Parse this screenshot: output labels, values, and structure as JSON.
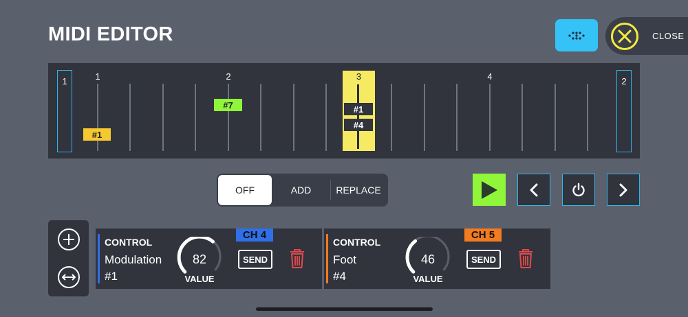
{
  "header": {
    "title": "MIDI EDITOR",
    "close_label": "CLOSE"
  },
  "colors": {
    "background": "#5a616c",
    "panel": "#31333d",
    "accent_blue": "#35c2f6",
    "marker_blue": "#2fb7ec",
    "playhead_yellow": "#f6ea62",
    "event_yellow": "#f6c930",
    "event_green": "#8ff63a",
    "close_yellow": "#f6ea3e",
    "play_green": "#8ff63a",
    "channel_blue": "#2f6fe8",
    "channel_orange": "#f27a1f",
    "trash_red": "#e24a4a"
  },
  "timeline": {
    "loop_start_label": "1",
    "loop_end_label": "2",
    "beats": [
      "1",
      "2",
      "3",
      "4"
    ],
    "playhead_label": "3",
    "events": [
      {
        "label": "#1",
        "color": "yellow"
      },
      {
        "label": "#7",
        "color": "green"
      }
    ],
    "playhead_events": [
      "#1",
      "#4"
    ]
  },
  "mode": {
    "options": [
      "OFF",
      "ADD",
      "REPLACE"
    ],
    "selected": "OFF"
  },
  "transport": {
    "icons": [
      "play-icon",
      "chevron-left-icon",
      "power-icon",
      "chevron-right-icon"
    ]
  },
  "side_panel": {
    "icons": [
      "add-circle-icon",
      "swap-horizontal-icon"
    ]
  },
  "cards": [
    {
      "type": "CONTROL",
      "name": "Modulation",
      "ref": "#1",
      "value": "82",
      "value_label": "VALUE",
      "channel": "CH 4",
      "send_label": "SEND",
      "level": 0.65
    },
    {
      "type": "CONTROL",
      "name": "Foot",
      "ref": "#4",
      "value": "46",
      "value_label": "VALUE",
      "channel": "CH 5",
      "send_label": "SEND",
      "level": 0.36
    }
  ]
}
